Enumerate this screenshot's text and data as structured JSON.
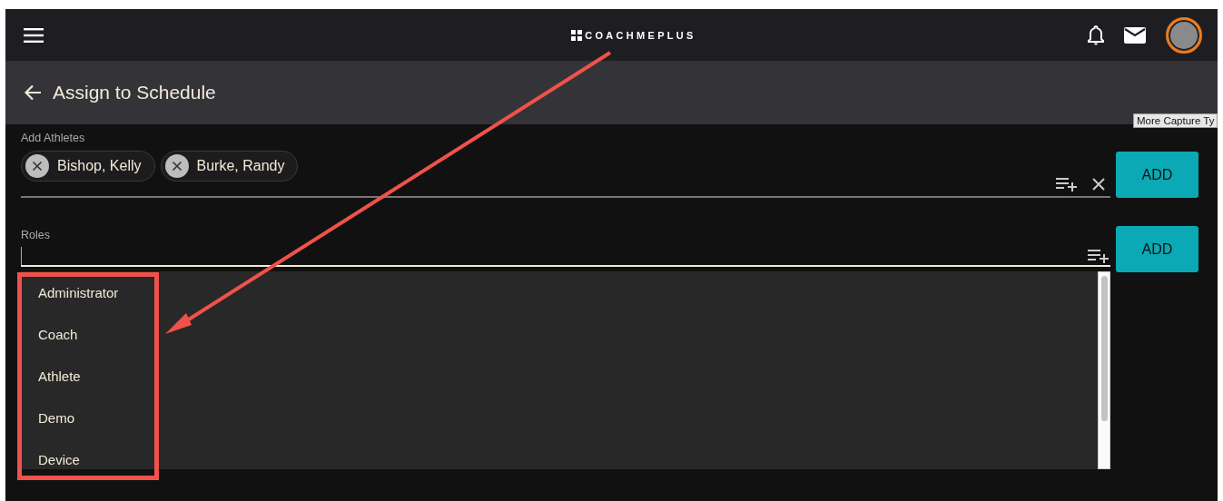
{
  "header": {
    "logo": "COACHMEPLUS"
  },
  "page_title": "Assign to Schedule",
  "athletes_field": {
    "label": "Add Athletes",
    "chips": [
      "Bishop, Kelly",
      "Burke, Randy"
    ],
    "button": "ADD"
  },
  "roles_field": {
    "label": "Roles",
    "button": "ADD",
    "options": [
      "Administrator",
      "Coach",
      "Athlete",
      "Demo",
      "Device"
    ]
  },
  "tooltip": "More Capture Ty"
}
